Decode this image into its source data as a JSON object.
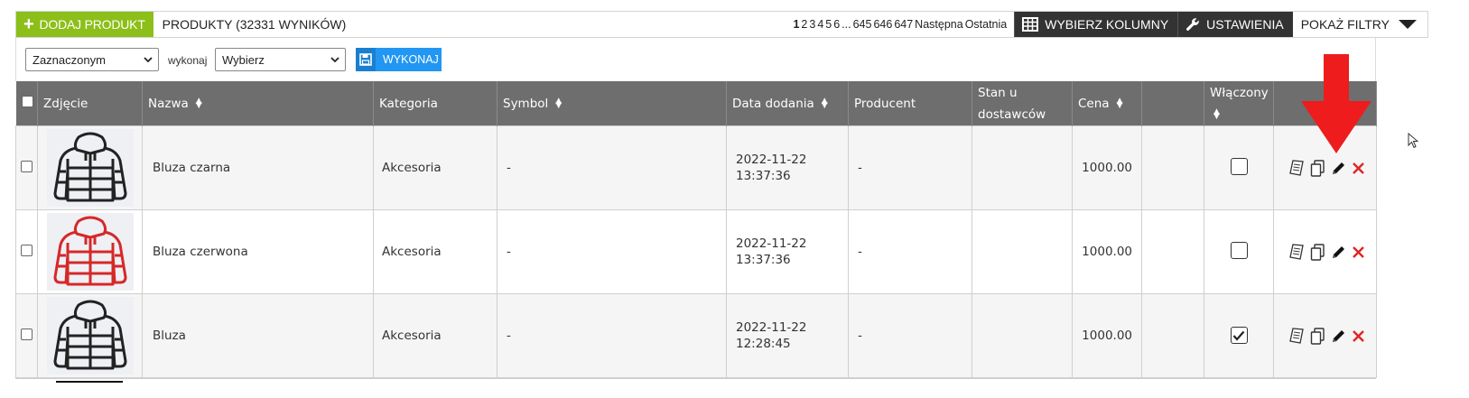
{
  "toolbar": {
    "add_product_label": "DODAJ PRODUKT",
    "products_count_label": "PRODUKTY (32331 WYNIKÓW)",
    "pagination": {
      "current": "1",
      "pages": [
        "2",
        "3",
        "4",
        "5",
        "6"
      ],
      "ellipsis": "...",
      "last_pages": [
        "645",
        "646",
        "647"
      ],
      "next_label": "Następna",
      "last_label": "Ostatnia"
    },
    "choose_columns_label": "WYBIERZ KOLUMNY",
    "settings_label": "USTAWIENIA",
    "show_filters_label": "POKAŻ FILTRY"
  },
  "action_bar": {
    "scope_select_value": "Zaznaczonym",
    "perform_label": "wykonaj",
    "action_select_value": "Wybierz",
    "execute_button_label": "WYKONAJ"
  },
  "table": {
    "headers": {
      "photo": "Zdjęcie",
      "name": "Nazwa",
      "category": "Kategoria",
      "symbol": "Symbol",
      "date_added": "Data dodania",
      "manufacturer": "Producent",
      "supplier_stock_line1": "Stan u",
      "supplier_stock_line2": "dostawców",
      "price": "Cena",
      "enabled": "Włączony"
    },
    "rows": [
      {
        "name": "Bluza czarna",
        "category": "Akcesoria",
        "symbol": "-",
        "date": "2022-11-22",
        "time": "13:37:36",
        "manufacturer": "-",
        "price": "1000.00",
        "enabled": false,
        "jacket_color": "#222222"
      },
      {
        "name": "Bluza czerwona",
        "category": "Akcesoria",
        "symbol": "-",
        "date": "2022-11-22",
        "time": "13:37:36",
        "manufacturer": "-",
        "price": "1000.00",
        "enabled": false,
        "jacket_color": "#d62828"
      },
      {
        "name": "Bluza",
        "category": "Akcesoria",
        "symbol": "-",
        "date": "2022-11-22",
        "time": "12:28:45",
        "manufacturer": "-",
        "price": "1000.00",
        "enabled": true,
        "jacket_color": "#222222"
      }
    ]
  },
  "colors": {
    "accent_green": "#8cbf1a",
    "execute_blue": "#2196f3",
    "header_gray": "#6e6e6e",
    "delete_red": "#e02424",
    "annotation_arrow": "#ee1c1c"
  }
}
